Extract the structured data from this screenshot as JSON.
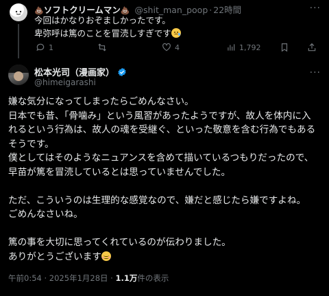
{
  "reply": {
    "name": "ソフトクリームマン",
    "name_emoji": "💩",
    "handle": "@shit_man_poop",
    "separator": "·",
    "time": "22時間",
    "lines": [
      "今回はかなりおぞましかったです。",
      "卑弥呼は篤のことを冒涜しすぎです"
    ],
    "actions": {
      "replies": "1",
      "reposts": "",
      "likes": "4",
      "views": "1,792"
    }
  },
  "tweet": {
    "name": "松本光司（漫画家）",
    "handle": "@himeigarashi",
    "lines": [
      "嫌な気分になってしまったらごめんなさい。",
      "日本でも昔、「骨噛み」という風習があったようですが、故人を体内に入",
      "れるという行為は、故人の魂を受継ぐ、といった敬意を含む行為でもある",
      "そうです。",
      "僕としてはそのようなニュアンスを含めて描いているつもりだったので、",
      "早苗が篤を冒涜しているとは思っていませんでした。",
      "",
      "ただ、こういうのは生理的な感覚なので、嫌だと感じたら嫌ですよね。",
      "ごめんなさいね。",
      "",
      "篤の事を大切に思ってくれているのが伝わりました。",
      "ありがとうございます"
    ],
    "meta": {
      "time": "午前0:54",
      "date": "2025年1月28日",
      "views": "1.1万",
      "views_label": "件の表示",
      "separator": "·"
    }
  },
  "colors": {
    "background": "#000000",
    "text": "#e7e9ea",
    "muted": "#71767b",
    "verified": "#1d9bf0",
    "thread_line": "#333639"
  }
}
